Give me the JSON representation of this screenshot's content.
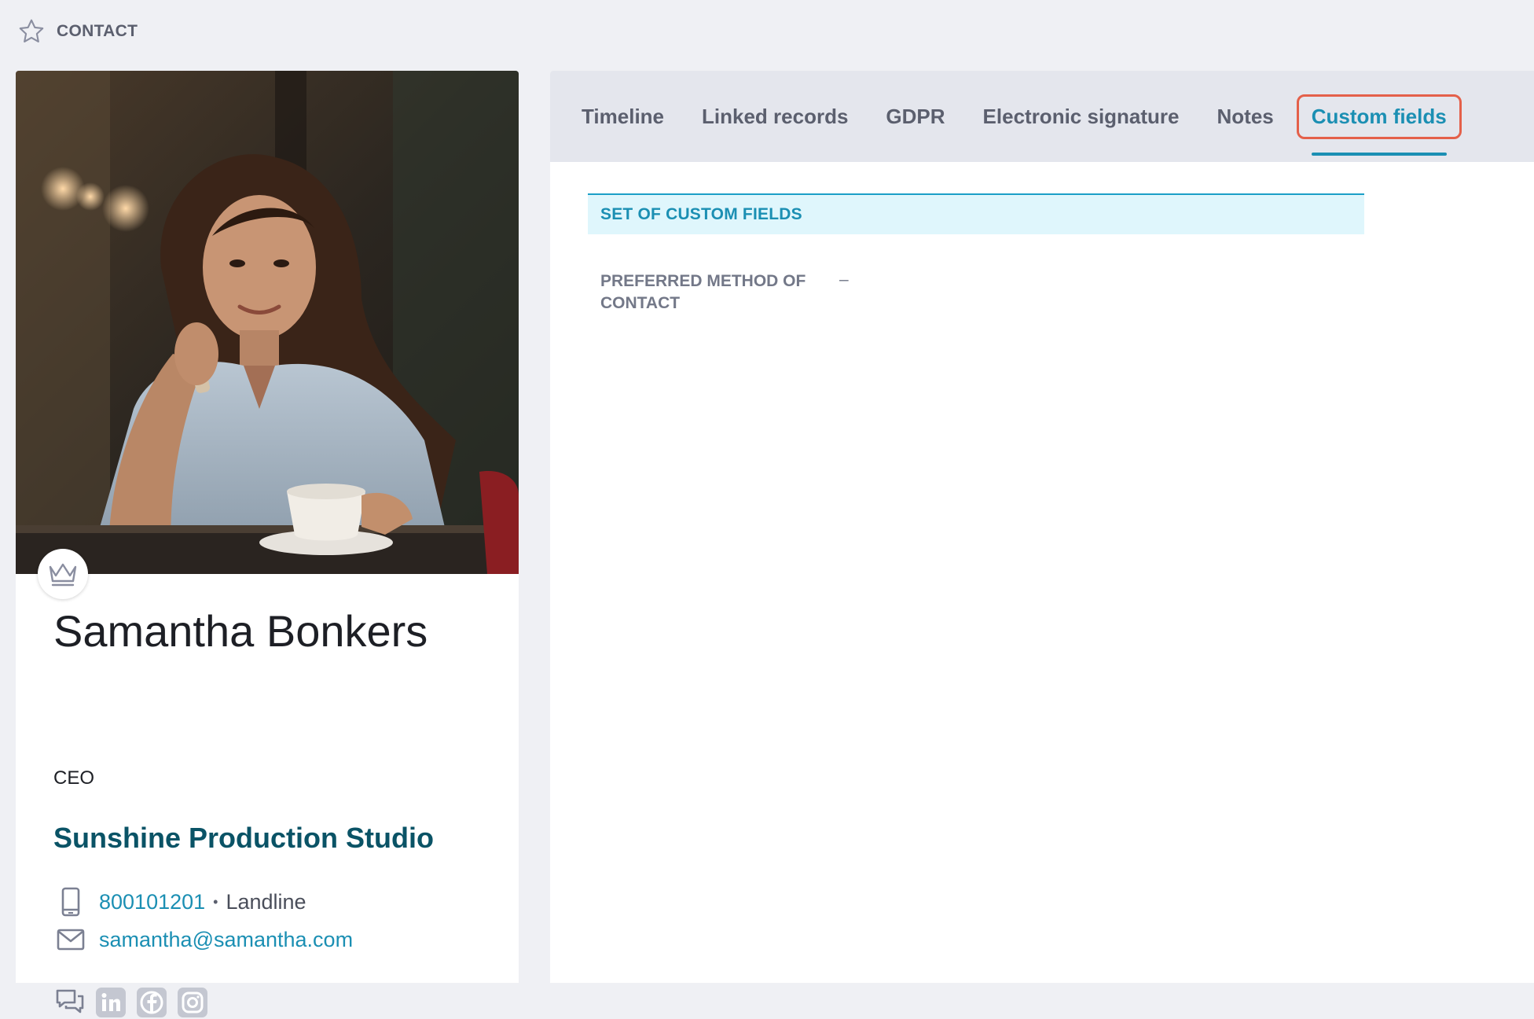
{
  "header": {
    "title": "CONTACT",
    "star_icon": "star-outline-icon"
  },
  "contact": {
    "name": "Samantha Bonkers",
    "job_title": "CEO",
    "company": "Sunshine Production Studio",
    "phone": {
      "number": "800101201",
      "separator": "•",
      "type": "Landline",
      "icon": "mobile-phone-icon"
    },
    "email": {
      "address": "samantha@samantha.com",
      "icon": "envelope-icon"
    },
    "badge_icon": "crown-icon",
    "social_icons": [
      "chat-bubbles-icon",
      "linkedin-icon",
      "facebook-icon",
      "instagram-icon"
    ]
  },
  "tabs": [
    {
      "label": "Timeline",
      "active": false
    },
    {
      "label": "Linked records",
      "active": false
    },
    {
      "label": "GDPR",
      "active": false
    },
    {
      "label": "Electronic signature",
      "active": false
    },
    {
      "label": "Notes",
      "active": false
    },
    {
      "label": "Custom fields",
      "active": true
    }
  ],
  "custom_fields": {
    "section_title": "SET OF CUSTOM FIELDS",
    "fields": [
      {
        "label": "PREFERRED METHOD OF CONTACT",
        "value": "–"
      }
    ]
  },
  "colors": {
    "accent": "#1b8fb3",
    "highlight_border": "#e4604a",
    "company": "#0a5366",
    "background": "#eff0f4"
  }
}
